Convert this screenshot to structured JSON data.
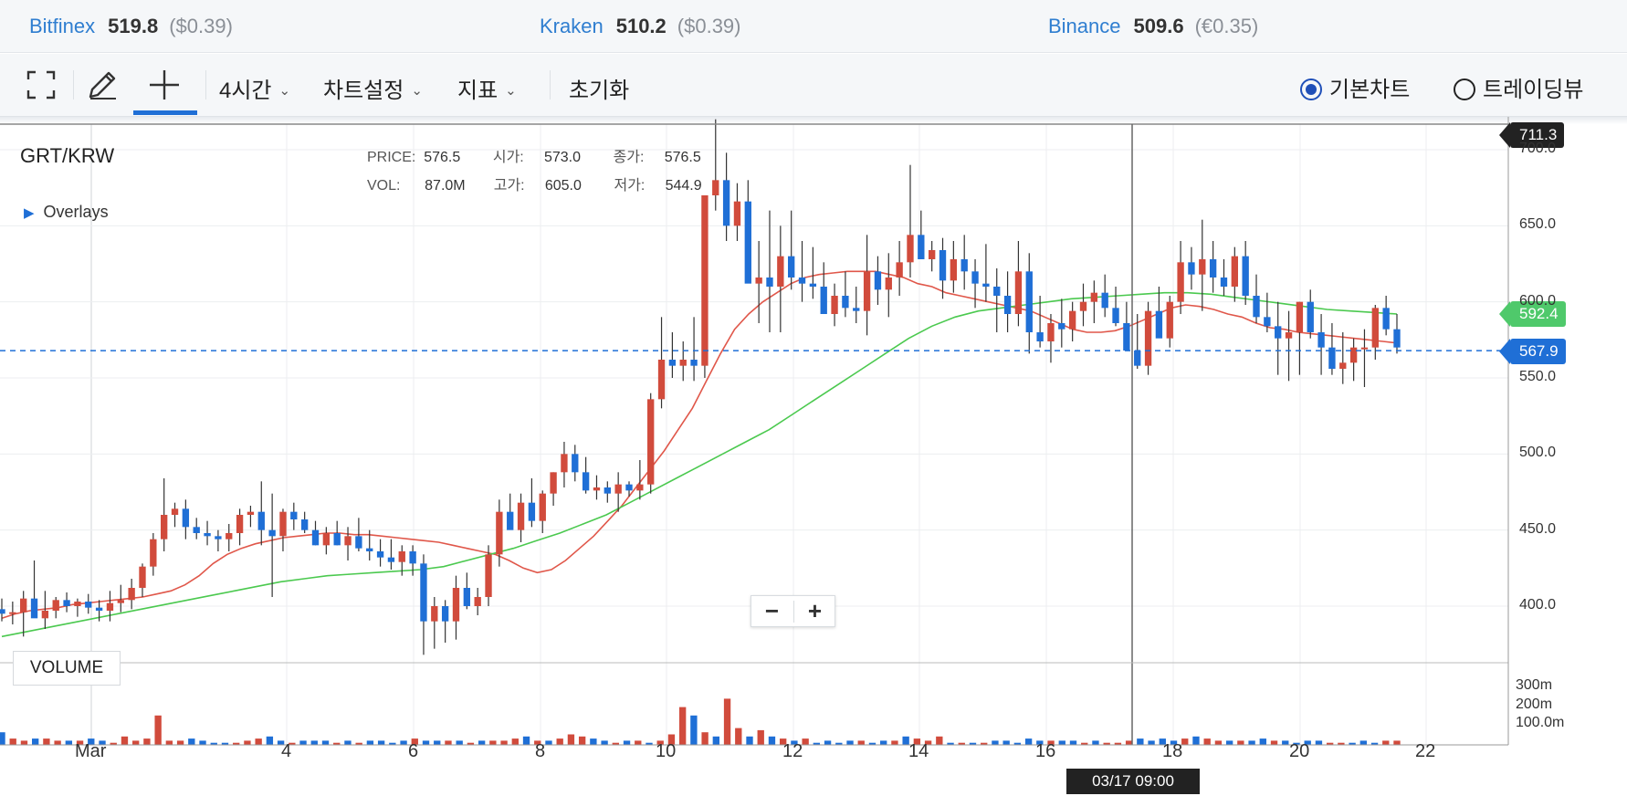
{
  "exchanges": [
    {
      "name": "Bitfinex",
      "price": "519.8",
      "sub": "($0.39)"
    },
    {
      "name": "Kraken",
      "price": "510.2",
      "sub": "($0.39)"
    },
    {
      "name": "Binance",
      "price": "509.6",
      "sub": "(€0.35)"
    }
  ],
  "toolbar": {
    "icons": [
      "fullscreen-icon",
      "pencil-icon",
      "crosshair-icon"
    ],
    "interval": "4시간",
    "chart_settings": "차트설정",
    "indicators": "지표",
    "reset": "초기화",
    "modes": [
      {
        "label": "기본차트",
        "selected": true
      },
      {
        "label": "트레이딩뷰",
        "selected": false
      }
    ]
  },
  "chart": {
    "pair": "GRT/KRW",
    "overlays_label": "Overlays",
    "info": {
      "price_label": "PRICE:",
      "price": "576.5",
      "open_label": "시가:",
      "open": "573.0",
      "close_label": "종가:",
      "close": "576.5",
      "vol_label": "VOL:",
      "vol": "87.0M",
      "high_label": "고가:",
      "high": "605.0",
      "low_label": "저가:",
      "low": "544.9"
    },
    "badges": {
      "crosshair_price": "711.3",
      "ma_long": "592.4",
      "last_price": "567.9"
    },
    "crosshair_time": "03/17 09:00",
    "volume_label": "VOLUME",
    "zoom_out": "−",
    "zoom_in": "+"
  },
  "chart_data": {
    "type": "candlestick",
    "y_axis": {
      "ticks": [
        "700.0",
        "650.0",
        "600.0",
        "550.0",
        "500.0",
        "450.0",
        "400.0"
      ]
    },
    "volume_axis": {
      "ticks": [
        "300m",
        "200m",
        "100.0m"
      ]
    },
    "x_axis": {
      "ticks": [
        "Mar",
        "4",
        "6",
        "8",
        "10",
        "12",
        "14",
        "16",
        "18",
        "20",
        "22"
      ]
    },
    "colors": {
      "up": "#d14b3c",
      "down": "#1f6fd6",
      "ma_short": "#e0574a",
      "ma_long": "#4bc94f",
      "last_price_line": "#1f6fd6"
    },
    "candles_ohlc": [
      [
        398,
        405,
        390,
        395
      ],
      [
        395,
        403,
        388,
        396
      ],
      [
        396,
        410,
        380,
        405
      ],
      [
        405,
        430,
        395,
        392
      ],
      [
        392,
        410,
        385,
        397
      ],
      [
        397,
        406,
        392,
        404
      ],
      [
        404,
        409,
        396,
        400
      ],
      [
        400,
        405,
        393,
        403
      ],
      [
        403,
        408,
        395,
        399
      ],
      [
        399,
        404,
        390,
        397
      ],
      [
        397,
        410,
        390,
        402
      ],
      [
        402,
        414,
        396,
        404
      ],
      [
        404,
        418,
        398,
        412
      ],
      [
        412,
        428,
        406,
        426
      ],
      [
        426,
        448,
        420,
        444
      ],
      [
        444,
        484,
        436,
        460
      ],
      [
        460,
        468,
        452,
        464
      ],
      [
        464,
        470,
        444,
        452
      ],
      [
        452,
        458,
        444,
        448
      ],
      [
        448,
        456,
        440,
        446
      ],
      [
        446,
        450,
        436,
        444
      ],
      [
        444,
        454,
        436,
        448
      ],
      [
        448,
        464,
        440,
        460
      ],
      [
        460,
        466,
        452,
        462
      ],
      [
        462,
        482,
        440,
        450
      ],
      [
        450,
        474,
        406,
        446
      ],
      [
        446,
        464,
        436,
        462
      ],
      [
        462,
        468,
        450,
        457
      ],
      [
        457,
        462,
        448,
        450
      ],
      [
        450,
        456,
        440,
        440
      ],
      [
        440,
        452,
        434,
        448
      ],
      [
        448,
        456,
        440,
        440
      ],
      [
        440,
        452,
        430,
        446
      ],
      [
        446,
        458,
        436,
        438
      ],
      [
        438,
        450,
        430,
        436
      ],
      [
        436,
        444,
        426,
        432
      ],
      [
        432,
        444,
        424,
        429
      ],
      [
        429,
        440,
        420,
        436
      ],
      [
        436,
        440,
        420,
        428
      ],
      [
        428,
        434,
        368,
        390
      ],
      [
        390,
        406,
        372,
        400
      ],
      [
        400,
        404,
        376,
        390
      ],
      [
        390,
        420,
        378,
        412
      ],
      [
        412,
        422,
        398,
        400
      ],
      [
        400,
        412,
        394,
        406
      ],
      [
        406,
        440,
        400,
        434
      ],
      [
        434,
        470,
        426,
        462
      ],
      [
        462,
        474,
        452,
        450
      ],
      [
        450,
        474,
        442,
        468
      ],
      [
        468,
        484,
        452,
        456
      ],
      [
        456,
        476,
        448,
        474
      ],
      [
        474,
        488,
        466,
        488
      ],
      [
        488,
        508,
        478,
        500
      ],
      [
        500,
        506,
        482,
        488
      ],
      [
        488,
        498,
        474,
        476
      ],
      [
        476,
        486,
        470,
        478
      ],
      [
        478,
        482,
        468,
        474
      ],
      [
        474,
        488,
        462,
        480
      ],
      [
        480,
        482,
        472,
        476
      ],
      [
        476,
        496,
        470,
        480
      ],
      [
        480,
        540,
        474,
        536
      ],
      [
        536,
        590,
        530,
        562
      ],
      [
        562,
        580,
        550,
        558
      ],
      [
        558,
        574,
        548,
        562
      ],
      [
        562,
        590,
        548,
        558
      ],
      [
        558,
        660,
        550,
        670
      ],
      [
        670,
        720,
        660,
        680
      ],
      [
        680,
        698,
        640,
        650
      ],
      [
        650,
        678,
        640,
        666
      ],
      [
        666,
        680,
        626,
        612
      ],
      [
        612,
        640,
        586,
        616
      ],
      [
        616,
        660,
        580,
        610
      ],
      [
        610,
        650,
        580,
        630
      ],
      [
        630,
        660,
        608,
        616
      ],
      [
        616,
        640,
        600,
        612
      ],
      [
        612,
        636,
        602,
        610
      ],
      [
        610,
        626,
        594,
        592
      ],
      [
        592,
        612,
        584,
        604
      ],
      [
        604,
        620,
        590,
        596
      ],
      [
        596,
        610,
        586,
        594
      ],
      [
        594,
        644,
        578,
        620
      ],
      [
        620,
        630,
        598,
        608
      ],
      [
        608,
        632,
        590,
        616
      ],
      [
        616,
        640,
        604,
        626
      ],
      [
        626,
        690,
        616,
        644
      ],
      [
        644,
        660,
        630,
        628
      ],
      [
        628,
        640,
        620,
        634
      ],
      [
        634,
        642,
        602,
        614
      ],
      [
        614,
        640,
        606,
        628
      ],
      [
        628,
        644,
        608,
        620
      ],
      [
        620,
        628,
        596,
        612
      ],
      [
        612,
        638,
        600,
        610
      ],
      [
        610,
        622,
        580,
        604
      ],
      [
        604,
        620,
        580,
        592
      ],
      [
        592,
        640,
        584,
        620
      ],
      [
        620,
        632,
        566,
        580
      ],
      [
        580,
        604,
        570,
        574
      ],
      [
        574,
        592,
        560,
        586
      ],
      [
        586,
        602,
        570,
        582
      ],
      [
        582,
        600,
        574,
        594
      ],
      [
        594,
        612,
        584,
        600
      ],
      [
        600,
        614,
        586,
        606
      ],
      [
        606,
        618,
        590,
        596
      ],
      [
        596,
        610,
        584,
        586
      ],
      [
        586,
        600,
        572,
        568
      ],
      [
        568,
        592,
        556,
        558
      ],
      [
        558,
        600,
        552,
        594
      ],
      [
        594,
        610,
        586,
        576
      ],
      [
        576,
        604,
        570,
        600
      ],
      [
        600,
        640,
        592,
        626
      ],
      [
        626,
        636,
        608,
        618
      ],
      [
        618,
        654,
        594,
        628
      ],
      [
        628,
        640,
        606,
        616
      ],
      [
        616,
        628,
        604,
        610
      ],
      [
        610,
        636,
        600,
        630
      ],
      [
        630,
        640,
        598,
        604
      ],
      [
        604,
        618,
        586,
        590
      ],
      [
        590,
        606,
        580,
        584
      ],
      [
        584,
        600,
        552,
        576
      ],
      [
        576,
        594,
        548,
        580
      ],
      [
        580,
        600,
        552,
        600
      ],
      [
        600,
        608,
        576,
        580
      ],
      [
        580,
        592,
        552,
        570
      ],
      [
        570,
        586,
        552,
        556
      ],
      [
        556,
        580,
        546,
        560
      ],
      [
        560,
        576,
        548,
        570
      ],
      [
        570,
        582,
        544,
        570
      ],
      [
        570,
        598,
        562,
        596
      ],
      [
        596,
        604,
        578,
        582
      ],
      [
        582,
        592,
        566,
        570
      ]
    ],
    "ma_short": [
      392,
      395,
      397,
      398,
      399,
      401,
      402,
      403,
      404,
      405,
      406,
      408,
      410,
      414,
      420,
      428,
      434,
      438,
      441,
      443,
      445,
      446,
      447,
      448,
      448,
      447,
      447,
      446,
      445,
      444,
      443,
      442,
      440,
      438,
      436,
      434,
      430,
      425,
      422,
      424,
      430,
      438,
      446,
      456,
      466,
      478,
      490,
      502,
      516,
      530,
      548,
      566,
      582,
      592,
      600,
      606,
      612,
      616,
      618,
      619,
      620,
      620,
      620,
      618,
      616,
      612,
      610,
      606,
      604,
      602,
      600,
      598,
      596,
      594,
      590,
      586,
      582,
      580,
      580,
      581,
      584,
      588,
      592,
      596,
      598,
      597,
      595,
      592,
      590,
      586,
      583,
      582,
      580,
      579,
      578,
      577,
      576,
      575,
      574,
      573
    ],
    "ma_long": [
      380,
      383,
      386,
      389,
      392,
      395,
      398,
      401,
      404,
      407,
      410,
      413,
      416,
      418,
      420,
      421,
      422,
      423,
      424,
      426,
      430,
      434,
      438,
      443,
      448,
      454,
      460,
      468,
      476,
      484,
      492,
      500,
      508,
      516,
      526,
      536,
      546,
      556,
      566,
      576,
      584,
      590,
      594,
      596,
      598,
      600,
      602,
      603,
      604,
      605,
      606,
      606,
      605,
      603,
      601,
      599,
      597,
      595,
      594,
      593,
      592
    ]
  }
}
